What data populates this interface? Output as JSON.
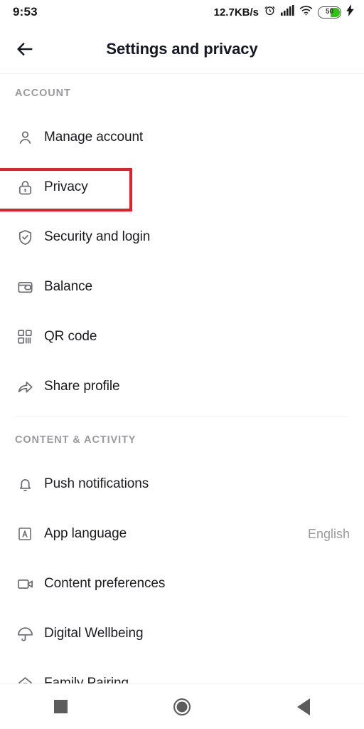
{
  "status_bar": {
    "time": "9:53",
    "network_speed": "12.7KB/s",
    "alarm_icon": "alarm-clock-icon",
    "signal_icon": "cellular-signal-icon",
    "wifi_icon": "wifi-icon",
    "battery_level": "50",
    "charging_icon": "charging-bolt-icon"
  },
  "header": {
    "back_icon": "back-arrow-icon",
    "title": "Settings and privacy"
  },
  "sections": [
    {
      "title": "ACCOUNT",
      "items": [
        {
          "label": "Manage account",
          "icon": "person-icon",
          "value": ""
        },
        {
          "label": "Privacy",
          "icon": "lock-icon",
          "value": ""
        },
        {
          "label": "Security and login",
          "icon": "shield-check-icon",
          "value": ""
        },
        {
          "label": "Balance",
          "icon": "wallet-icon",
          "value": ""
        },
        {
          "label": "QR code",
          "icon": "qr-code-icon",
          "value": ""
        },
        {
          "label": "Share profile",
          "icon": "share-arrow-icon",
          "value": ""
        }
      ]
    },
    {
      "title": "CONTENT & ACTIVITY",
      "items": [
        {
          "label": "Push notifications",
          "icon": "bell-icon",
          "value": ""
        },
        {
          "label": "App language",
          "icon": "letter-a-box-icon",
          "value": "English"
        },
        {
          "label": "Content preferences",
          "icon": "video-camera-icon",
          "value": ""
        },
        {
          "label": "Digital Wellbeing",
          "icon": "umbrella-icon",
          "value": ""
        },
        {
          "label": "Family Pairing",
          "icon": "house-heart-icon",
          "value": ""
        }
      ]
    }
  ],
  "highlight": {
    "target_label": "Privacy",
    "color": "#e0202a"
  },
  "nav_bar": {
    "recents_icon": "square-recents-icon",
    "home_icon": "circle-home-icon",
    "back_icon": "triangle-back-icon"
  }
}
